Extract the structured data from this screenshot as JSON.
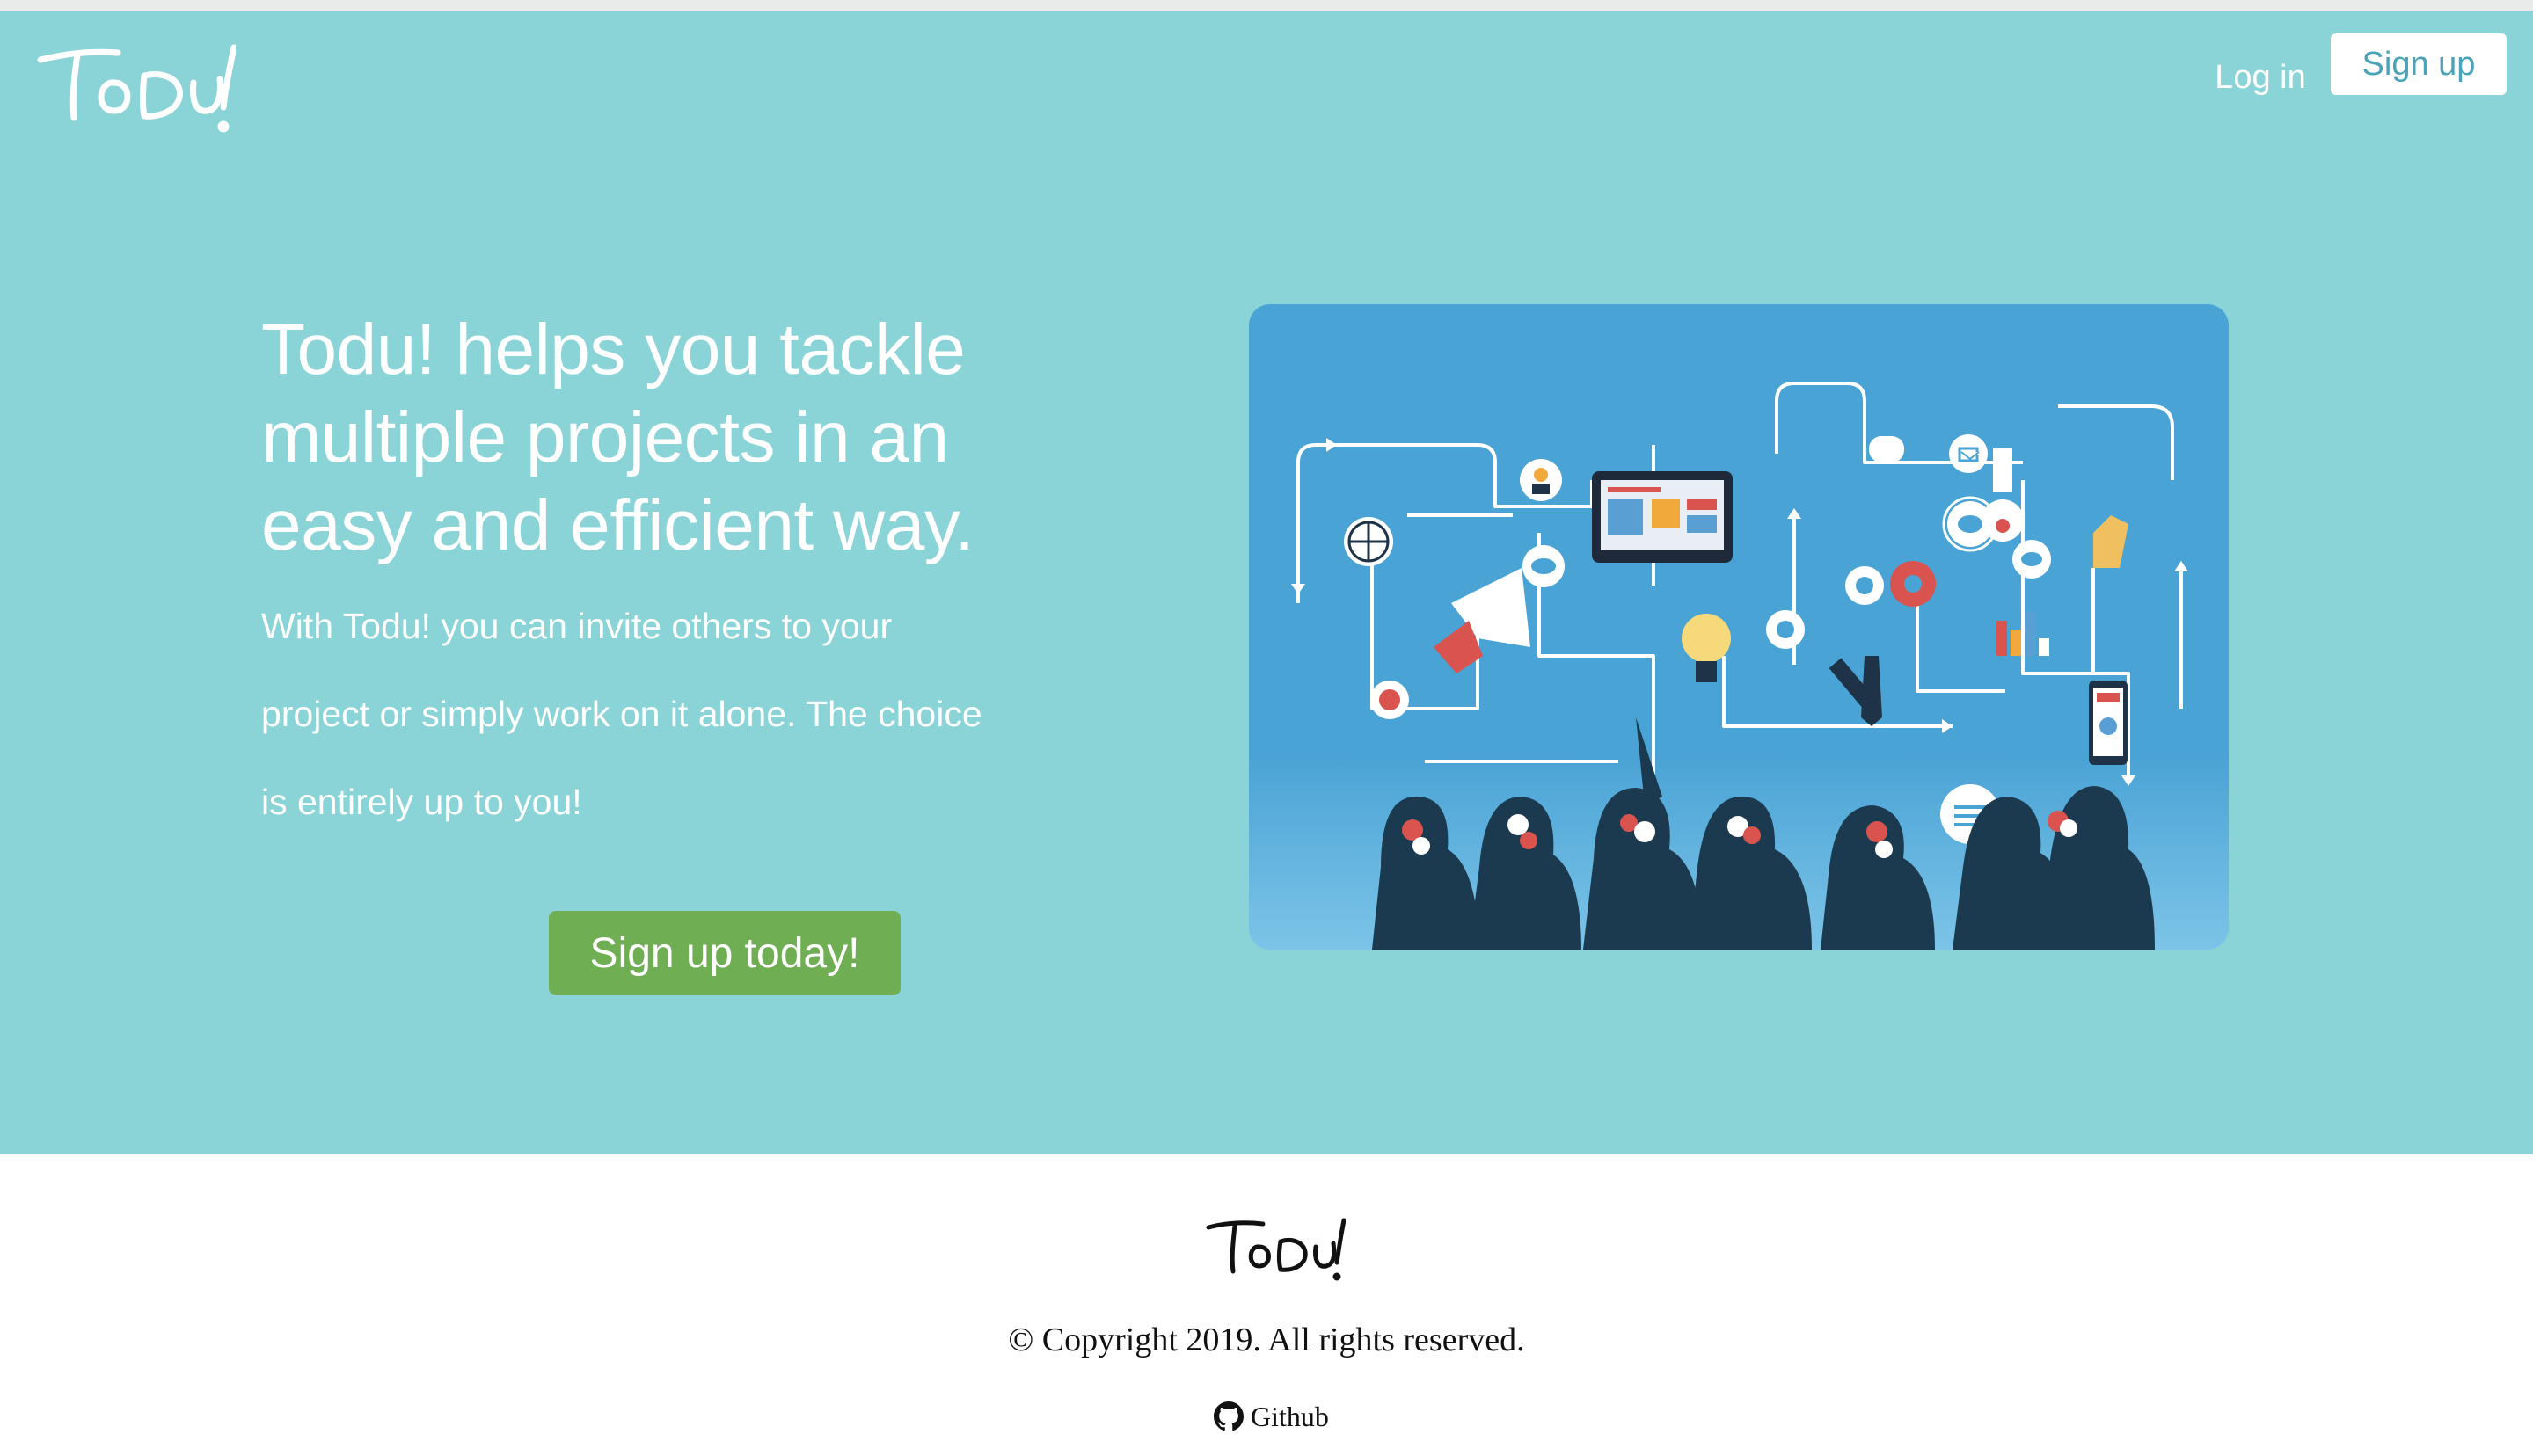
{
  "brand": {
    "logo_text": "Todu!"
  },
  "nav": {
    "login_label": "Log in",
    "signup_label": "Sign up"
  },
  "hero": {
    "headline": "Todu! helps you tackle multiple projects in an easy and efficient way.",
    "subtext": "With Todu! you can invite others to your project or simply work on it alone. The choice is entirely up to you!",
    "cta_label": "Sign up today!"
  },
  "illustration": {
    "icon": "team-collaboration-illustration"
  },
  "footer": {
    "logo_text": "Todu!",
    "copyright": "© Copyright 2019. All rights reserved.",
    "github_label": "Github",
    "github_icon": "github-icon"
  },
  "colors": {
    "hero_bg": "#8ad4d8",
    "cta_bg": "#6fae52",
    "signup_text": "#4aa3b8",
    "illustration_bg": "#4aa3d5"
  }
}
